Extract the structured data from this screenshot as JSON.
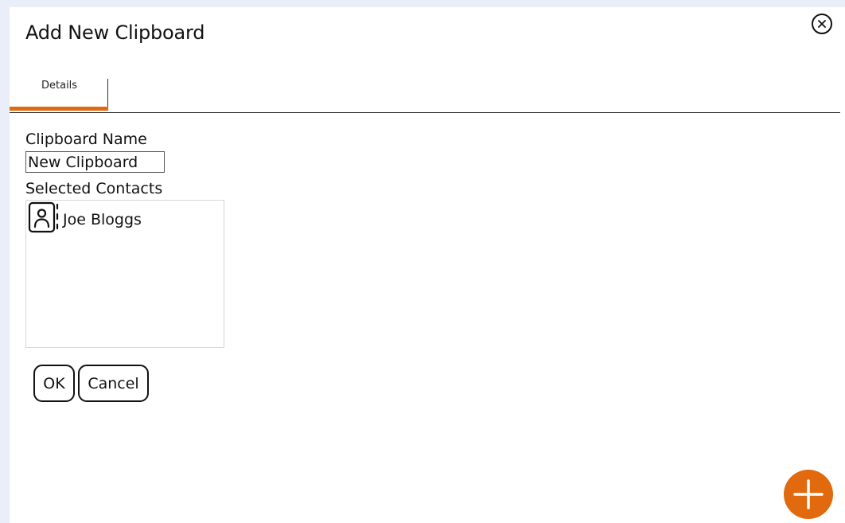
{
  "dialog": {
    "title": "Add New Clipboard",
    "close_icon": "close-circle-icon"
  },
  "tabs": [
    {
      "label": "Details",
      "active": true
    }
  ],
  "form": {
    "name_label": "Clipboard Name",
    "name_value": "New Clipboard",
    "contacts_label": "Selected Contacts",
    "contacts": [
      {
        "name": "Joe Bloggs",
        "icon": "contact-card-icon"
      }
    ]
  },
  "actions": {
    "ok_label": "OK",
    "cancel_label": "Cancel"
  },
  "fab": {
    "icon": "plus-icon"
  },
  "colors": {
    "accent": "#e1690e",
    "page_background": "#e9eef8",
    "dialog_background": "#ffffff"
  }
}
